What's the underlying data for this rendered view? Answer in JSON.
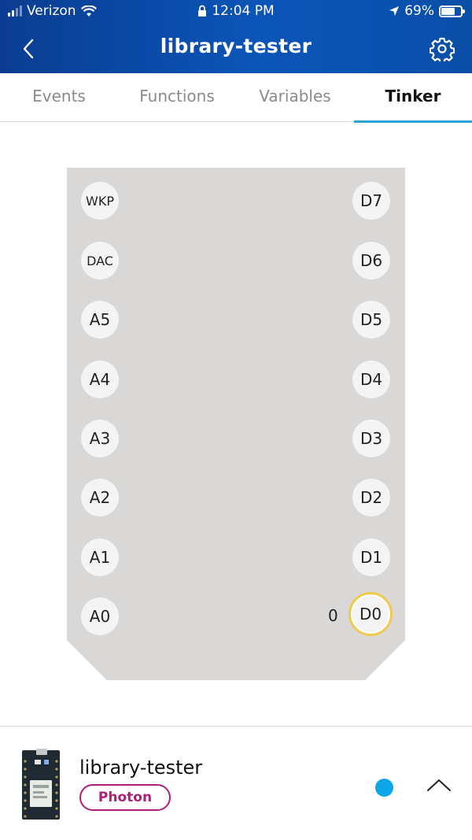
{
  "status_bar": {
    "carrier": "Verizon",
    "time": "12:04 PM",
    "battery": "69%"
  },
  "nav": {
    "title": "library-tester"
  },
  "tabs": [
    {
      "label": "Events",
      "active": false
    },
    {
      "label": "Functions",
      "active": false
    },
    {
      "label": "Variables",
      "active": false
    },
    {
      "label": "Tinker",
      "active": true
    }
  ],
  "board": {
    "left_pins": [
      "WKP",
      "DAC",
      "A5",
      "A4",
      "A3",
      "A2",
      "A1",
      "A0"
    ],
    "right_pins": [
      "D7",
      "D6",
      "D5",
      "D4",
      "D3",
      "D2",
      "D1",
      "D0"
    ],
    "selected_pin": "D0",
    "selected_value": "0"
  },
  "device": {
    "name": "library-tester",
    "type": "Photon",
    "status_color": "#0ea5e9"
  },
  "colors": {
    "header": "#0b55b8",
    "tab_indicator": "#2aa1d8",
    "board": "#d9d8d7",
    "selected_ring": "#f2c94c",
    "badge": "#b01d79"
  }
}
